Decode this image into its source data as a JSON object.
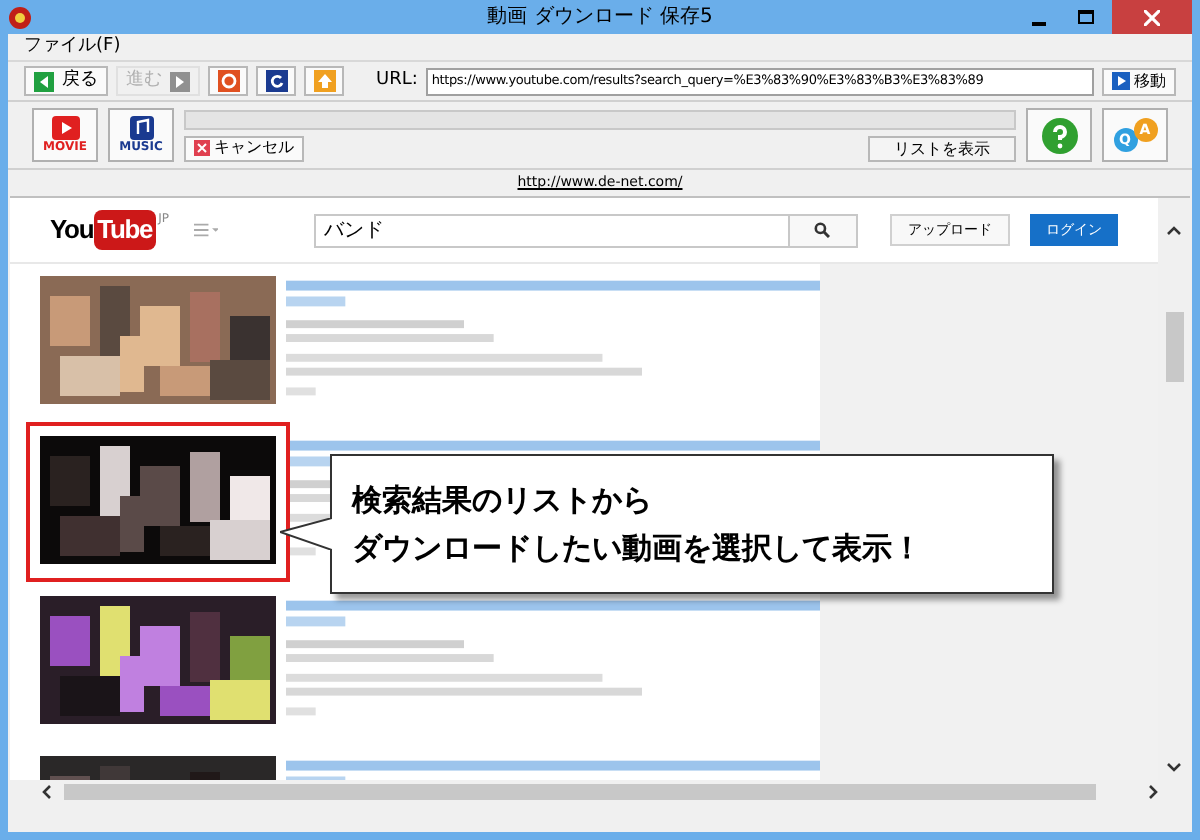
{
  "window": {
    "title": "動画 ダウンロード 保存5"
  },
  "menu": [
    "ファイル(F)"
  ],
  "nav": [
    {
      "kind": "back",
      "label": "戻る",
      "disabled": false
    },
    {
      "kind": "forward",
      "label": "進む",
      "disabled": true
    }
  ],
  "url_label": "URL:",
  "url": "https://www.youtube.com/results?search_query=%E3%83%90%E3%83%B3%E3%83%89",
  "go_button": "移動",
  "movie_button": "MOVIE",
  "music_button": "MUSIC",
  "progress": {
    "level": 0
  },
  "cancel_button": "キャンセル",
  "list_button": "リストを表示",
  "qa_icon": {
    "q": "Q",
    "a": "A"
  },
  "link": "http://www.de-net.com/",
  "youtube": {
    "logo_you": "You",
    "logo_tube": "Tube",
    "logo_region": "JP",
    "search_value": "バンド",
    "upload_button": "アップロード",
    "login_button": "ログイン"
  },
  "results": [
    {
      "kind": "picture",
      "highlighted": false
    },
    {
      "kind": "picture",
      "highlighted": true
    },
    {
      "kind": "picture",
      "highlighted": false
    },
    {
      "kind": "picture",
      "highlighted": false
    }
  ],
  "callout": [
    "検索結果のリストから",
    "ダウンロードしたい動画を選択して表示！"
  ]
}
